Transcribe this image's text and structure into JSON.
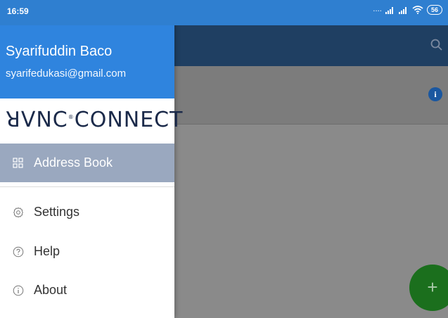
{
  "status_bar": {
    "time": "16:59",
    "signal_text": "....",
    "battery": "56"
  },
  "drawer": {
    "user_name": "Syarifuddin Baco",
    "user_email": "syarifedukasi@gmail.com",
    "logo_text": "RVNC CONNECT",
    "logo_display": "ꓤVNC",
    "logo_display_2": "CONNECT",
    "items": [
      {
        "label": "Address Book",
        "icon": "grid-icon",
        "active": true
      },
      {
        "label": "Settings",
        "icon": "gear-icon"
      },
      {
        "label": "Help",
        "icon": "help-icon"
      },
      {
        "label": "About",
        "icon": "info-icon"
      }
    ]
  },
  "background_app": {
    "fab_label": "+",
    "info_label": "i"
  },
  "colors": {
    "status_bar": "#2f7fd0",
    "drawer_header": "#2f84de",
    "active_item": "#9aa8bf",
    "fab": "#1b6f1d"
  }
}
